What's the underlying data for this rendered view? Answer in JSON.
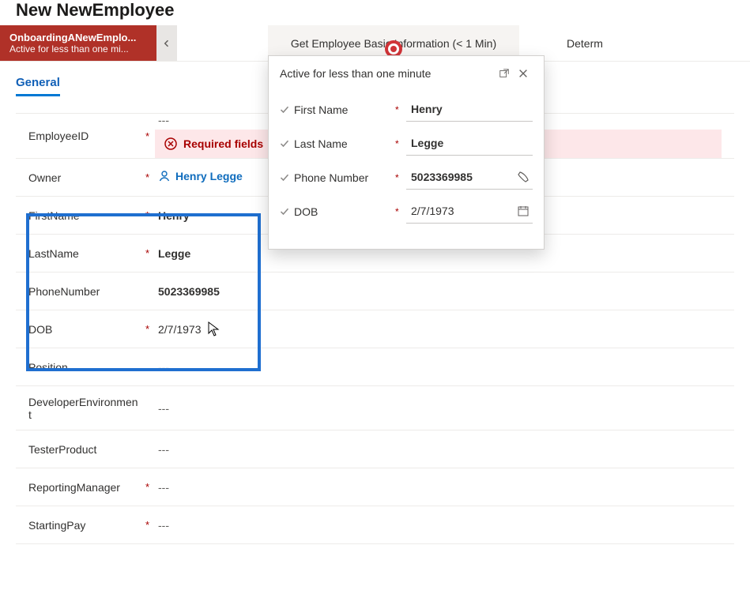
{
  "page_title": "New NewEmployee",
  "bpf": {
    "active_stage_name": "OnboardingANewEmplo...",
    "active_stage_sub": "Active for less than one mi...",
    "stage2": "Get Employee Basic Information  (< 1 Min)",
    "stage3": "Determ"
  },
  "tab_general": "General",
  "form": {
    "employee_id_label": "EmployeeID",
    "employee_id_value": "---",
    "error_text": "Required fields",
    "owner_label": "Owner",
    "owner_value": "Henry Legge",
    "first_name_label": "FirstName",
    "first_name_value": "Henry",
    "last_name_label": "LastName",
    "last_name_value": "Legge",
    "phone_label": "PhoneNumber",
    "phone_value": "5023369985",
    "dob_label": "DOB",
    "dob_value": "2/7/1973",
    "position_label": "Position",
    "position_value": "---",
    "devenv_label": "DeveloperEnvironment",
    "devenv_value": "---",
    "tester_label": "TesterProduct",
    "tester_value": "---",
    "mgr_label": "ReportingManager",
    "mgr_value": "---",
    "pay_label": "StartingPay",
    "pay_value": "---"
  },
  "flyout": {
    "title": "Active for less than one minute",
    "first_name_label": "First Name",
    "first_name_value": "Henry",
    "last_name_label": "Last Name",
    "last_name_value": "Legge",
    "phone_label": "Phone Number",
    "phone_value": "5023369985",
    "dob_label": "DOB",
    "dob_value": "2/7/1973"
  }
}
